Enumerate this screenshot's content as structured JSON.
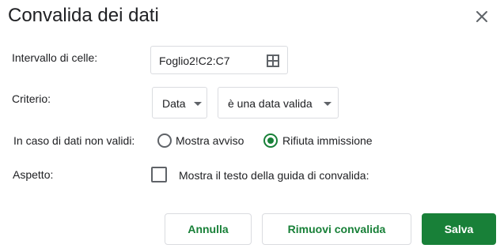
{
  "dialog": {
    "title": "Convalida dei dati",
    "close_icon": "close-icon"
  },
  "range": {
    "label": "Intervallo di celle:",
    "value": "Foglio2!C2:C7",
    "icon": "grid-select-icon"
  },
  "criteria": {
    "label": "Criterio:",
    "type_selected": "Data",
    "condition_selected": "è una data valida"
  },
  "invalid": {
    "label": "In caso di dati non validi:",
    "options": [
      {
        "label": "Mostra avviso",
        "checked": false
      },
      {
        "label": "Rifiuta immissione",
        "checked": true
      }
    ]
  },
  "appearance": {
    "label": "Aspetto:",
    "checkbox_label": "Mostra il testo della guida di convalida:",
    "checked": false
  },
  "buttons": {
    "cancel": "Annulla",
    "remove": "Rimuovi convalida",
    "save": "Salva"
  },
  "colors": {
    "accent": "#188038",
    "border": "#dadce0",
    "icon": "#5f6368"
  }
}
